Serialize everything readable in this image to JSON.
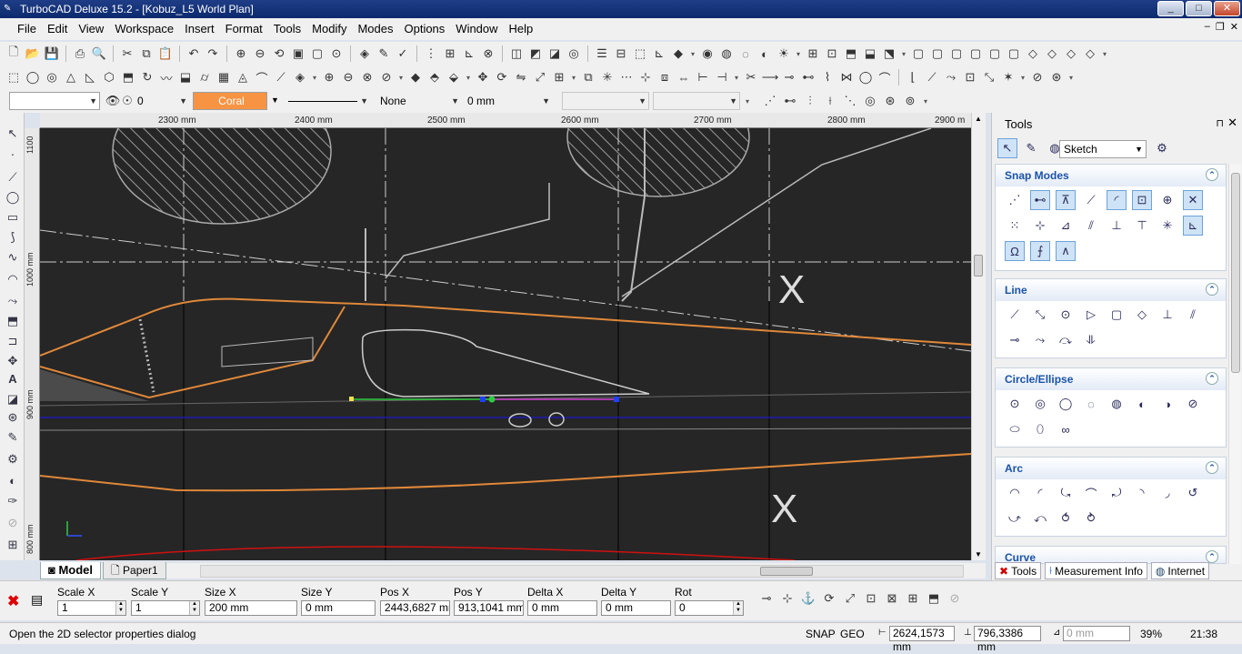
{
  "window": {
    "title": "TurboCAD Deluxe 15.2 - [Kobuz_L5 World Plan]",
    "minimize": "_",
    "maximize": "□",
    "close": "✕"
  },
  "menu": {
    "items": [
      "File",
      "Edit",
      "View",
      "Workspace",
      "Insert",
      "Format",
      "Tools",
      "Modify",
      "Modes",
      "Options",
      "Window",
      "Help"
    ],
    "mdi": [
      "–",
      "❐",
      "✕"
    ]
  },
  "toolbar1": {
    "icons": [
      "new-icon",
      "open-icon",
      "save-icon",
      "print-icon",
      "print-preview-icon",
      "cut-icon",
      "copy-icon",
      "paste-icon",
      "undo-icon",
      "redo-icon",
      "zoom-window-icon",
      "zoom-out-icon",
      "zoom-previous-icon",
      "zoom-extents-icon",
      "zoom-all-icon",
      "view-icon",
      "render-icon",
      "paint-icon",
      "spell-icon",
      "grid-icon",
      "snap-icon",
      "magnet-icon",
      "ortho-icon"
    ]
  },
  "propbar": {
    "layer": "",
    "visibility_value": "0",
    "color": "Coral",
    "line_style": "",
    "pattern": "None",
    "width": "0 mm",
    "disabled1": "",
    "disabled2": ""
  },
  "ruler": {
    "top_ticks": [
      "2300 mm",
      "2400 mm",
      "2500 mm",
      "2600 mm",
      "2700 mm",
      "2800 mm",
      "2900 m"
    ],
    "left_ticks": [
      "1100",
      "1000 mm",
      "900 mm",
      "800 mm"
    ]
  },
  "tabs": {
    "model": "Model",
    "paper": "Paper1"
  },
  "panel": {
    "title": "Tools",
    "pin": "⊓",
    "close": "✕",
    "mode": "Sketch",
    "sections": [
      {
        "name": "Snap Modes",
        "count": 19
      },
      {
        "name": "Line",
        "count": 12
      },
      {
        "name": "Circle/Ellipse",
        "count": 11
      },
      {
        "name": "Arc",
        "count": 12
      },
      {
        "name": "Curve",
        "count": 0
      }
    ],
    "bottom_tabs": [
      "Tools",
      "Measurement Info",
      "Internet"
    ]
  },
  "inspector": {
    "fields": [
      {
        "label": "Scale X",
        "value": "1"
      },
      {
        "label": "Scale Y",
        "value": "1"
      },
      {
        "label": "Size X",
        "value": "200 mm"
      },
      {
        "label": "Size Y",
        "value": "0 mm"
      },
      {
        "label": "Pos X",
        "value": "2443,6827 mm"
      },
      {
        "label": "Pos Y",
        "value": "913,1041 mm"
      },
      {
        "label": "Delta X",
        "value": "0 mm"
      },
      {
        "label": "Delta Y",
        "value": "0 mm"
      },
      {
        "label": "Rot",
        "value": "0"
      }
    ]
  },
  "status": {
    "message": "Open the 2D selector properties dialog",
    "snap": "SNAP",
    "geo": "GEO",
    "coord_x": "2624,1573 mm",
    "coord_y": "796,3386 mm",
    "coord_z": "0 mm",
    "zoom": "39%",
    "time": "21:38"
  },
  "colors": {
    "accent": "#f79443",
    "title": "#0c2a6e",
    "section_header": "#1b53a8",
    "drawing_line": "#e0883a"
  }
}
